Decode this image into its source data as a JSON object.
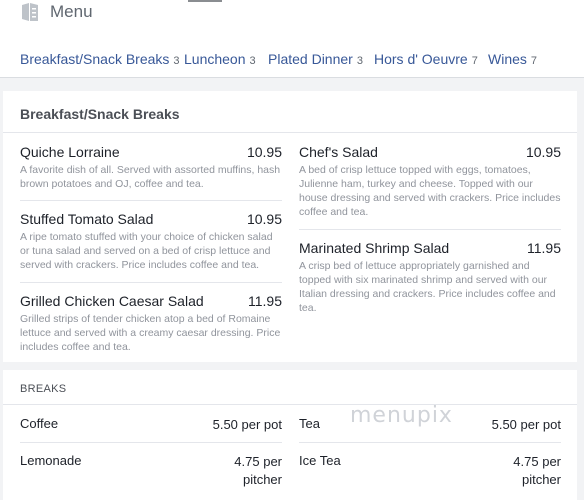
{
  "header": {
    "title": "Menu",
    "icon": "menu-book-icon"
  },
  "nav": [
    {
      "label": "Breakfast/Snack Breaks",
      "count": "3"
    },
    {
      "label": "Luncheon",
      "count": "3"
    },
    {
      "label": "Plated Dinner",
      "count": "3"
    },
    {
      "label": "Hors d' Oeuvre",
      "count": "7"
    },
    {
      "label": "Wines",
      "count": "7"
    }
  ],
  "section": {
    "title": "Breakfast/Snack Breaks",
    "items": [
      {
        "name": "Quiche Lorraine",
        "price": "10.95",
        "desc": "A favorite dish of all. Served with assorted muffins, hash brown potatoes and OJ, coffee and tea."
      },
      {
        "name": "Stuffed Tomato Salad",
        "price": "10.95",
        "desc": "A ripe tomato stuffed with your choice of chicken salad or tuna salad and served on a bed of crisp lettuce and served with crackers. Price includes coffee and tea."
      },
      {
        "name": "Grilled Chicken Caesar Salad",
        "price": "11.95",
        "desc": "Grilled strips of tender chicken atop a bed of Romaine lettuce and served with a creamy caesar dressing. Price includes coffee and tea."
      },
      {
        "name": "Chef's Salad",
        "price": "10.95",
        "desc": "A bed of crisp lettuce topped with eggs, tomatoes, Julienne ham, turkey and cheese. Topped with our house dressing and served with crackers. Price includes coffee and tea."
      },
      {
        "name": "Marinated Shrimp Salad",
        "price": "11.95",
        "desc": "A crisp bed of lettuce appropriately garnished and topped with six marinated shrimp and served with our Italian dressing and crackers. Price includes coffee and tea."
      }
    ]
  },
  "breaks": {
    "title": "BREAKS",
    "items": [
      {
        "name": "Coffee",
        "price": "5.50 per pot"
      },
      {
        "name": "Lemonade",
        "price": "4.75 per pitcher"
      },
      {
        "name": "Tea",
        "price": "5.50 per pot"
      },
      {
        "name": "Ice Tea",
        "price": "4.75 per pitcher"
      }
    ]
  },
  "watermark": "menupix"
}
